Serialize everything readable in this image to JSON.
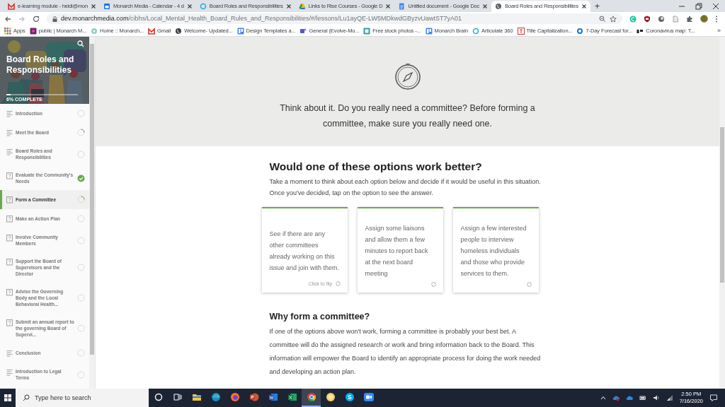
{
  "browser": {
    "tabs": [
      {
        "title": "e-learning module - heidi@mon",
        "selected": false
      },
      {
        "title": "Monarch Media - Calendar - 4 d",
        "selected": false
      },
      {
        "title": "Board Roles and Responsibilities",
        "selected": false
      },
      {
        "title": "Links to Rise Courses - Google D",
        "selected": false
      },
      {
        "title": "Untitled document - Google Doc",
        "selected": false
      },
      {
        "title": "Board Roles and Responsibilities",
        "selected": true
      }
    ],
    "new_tab": "+",
    "url_host": "dev.monarchmedia.com",
    "url_path": "/cibhs/Local_Mental_Health_Board_Rules_and_Responsibilities/#/lessons/Lu1ayQE-LW5MDkwdGByzvUawtST7yA01",
    "bookmarks": [
      "Apps",
      "public | Monarch M...",
      "Home :: Monarch...",
      "Gmail",
      "Welcome- Updated...",
      "Design Templates a...",
      "General (Evolve-Mo...",
      "Free stock photos -...",
      "Monarch Brain",
      "Articulate 360",
      "Title Capitalization...",
      "7-Day Forecast for...",
      "Coronavirus map: T..."
    ],
    "bookmarks_more": "»"
  },
  "course": {
    "title": "Board Roles and Responsibilities",
    "progress": {
      "label": "6% COMPLETE",
      "level": 0.06
    },
    "lessons": [
      {
        "title": "Introduction",
        "kind": "text",
        "started": false,
        "completed": false,
        "selected": false
      },
      {
        "title": "Meet the Board",
        "kind": "text",
        "started": true,
        "completed": false,
        "selected": false
      },
      {
        "title": "Board Roles and Responsibilities",
        "kind": "text",
        "started": false,
        "completed": false,
        "selected": false
      },
      {
        "title": "Evaluate the Community's Needs",
        "kind": "quiz",
        "completed": true,
        "selected": false
      },
      {
        "title": "Form a Committee",
        "kind": "quiz",
        "started": true,
        "completed": false,
        "selected": true
      },
      {
        "title": "Make an Action Plan",
        "kind": "quiz",
        "started": false,
        "completed": false,
        "selected": false
      },
      {
        "title": "Involve Community Members",
        "kind": "quiz",
        "started": false,
        "completed": false,
        "selected": false
      },
      {
        "title": "Support the Board of Supervisors and the Director",
        "kind": "quiz",
        "started": false,
        "completed": false,
        "selected": false
      },
      {
        "title": "Advise the Governing Body and the Local Behavioral Health...",
        "kind": "quiz",
        "started": false,
        "completed": false,
        "selected": false
      },
      {
        "title": "Submit an annual report to the governing Board of Supervi...",
        "kind": "quiz",
        "started": false,
        "completed": false,
        "selected": false
      },
      {
        "title": "Conclusion",
        "kind": "text",
        "started": false,
        "completed": false,
        "selected": false
      },
      {
        "title": "Introduction to Legal Terms",
        "kind": "text",
        "started": false,
        "completed": false,
        "selected": false
      }
    ]
  },
  "callout": {
    "text": "Think about it. Do you really need a committee? Before forming a committee, make sure you really need one."
  },
  "options": {
    "heading": "Would one of these options work better?",
    "intro": "Take a moment to think about each option below and decide if it would be useful in this situation. Once you've decided, tap on the option to see the answer.",
    "cards": [
      {
        "text": "See if there are any other committees already working on this issue and join with them.",
        "hint": "Click to flip"
      },
      {
        "text": "Assign some liaisons and allow them a few minutes to report back at the next board meeting"
      },
      {
        "text": "Assign a few interested people to interview homeless individuals and those who provide services to them."
      }
    ]
  },
  "why": {
    "heading": "Why form a committee?",
    "text": "If one of the options above won't work, forming a committee is probably your best bet. A committee will do the assigned research or work and bring information back to the Board. This information will empower the Board to identify an appropriate process for doing the work needed and developing an action plan."
  },
  "taskbar": {
    "search_placeholder": "Type here to search",
    "apps": [
      {
        "selected": false
      },
      {
        "selected": false
      },
      {
        "selected": false
      },
      {
        "selected": false
      },
      {
        "selected": false
      },
      {
        "selected": false
      },
      {
        "selected": true
      },
      {
        "selected": false
      },
      {
        "selected": false
      },
      {
        "selected": false
      }
    ],
    "time": "2:50 PM",
    "date": "7/16/2020"
  }
}
